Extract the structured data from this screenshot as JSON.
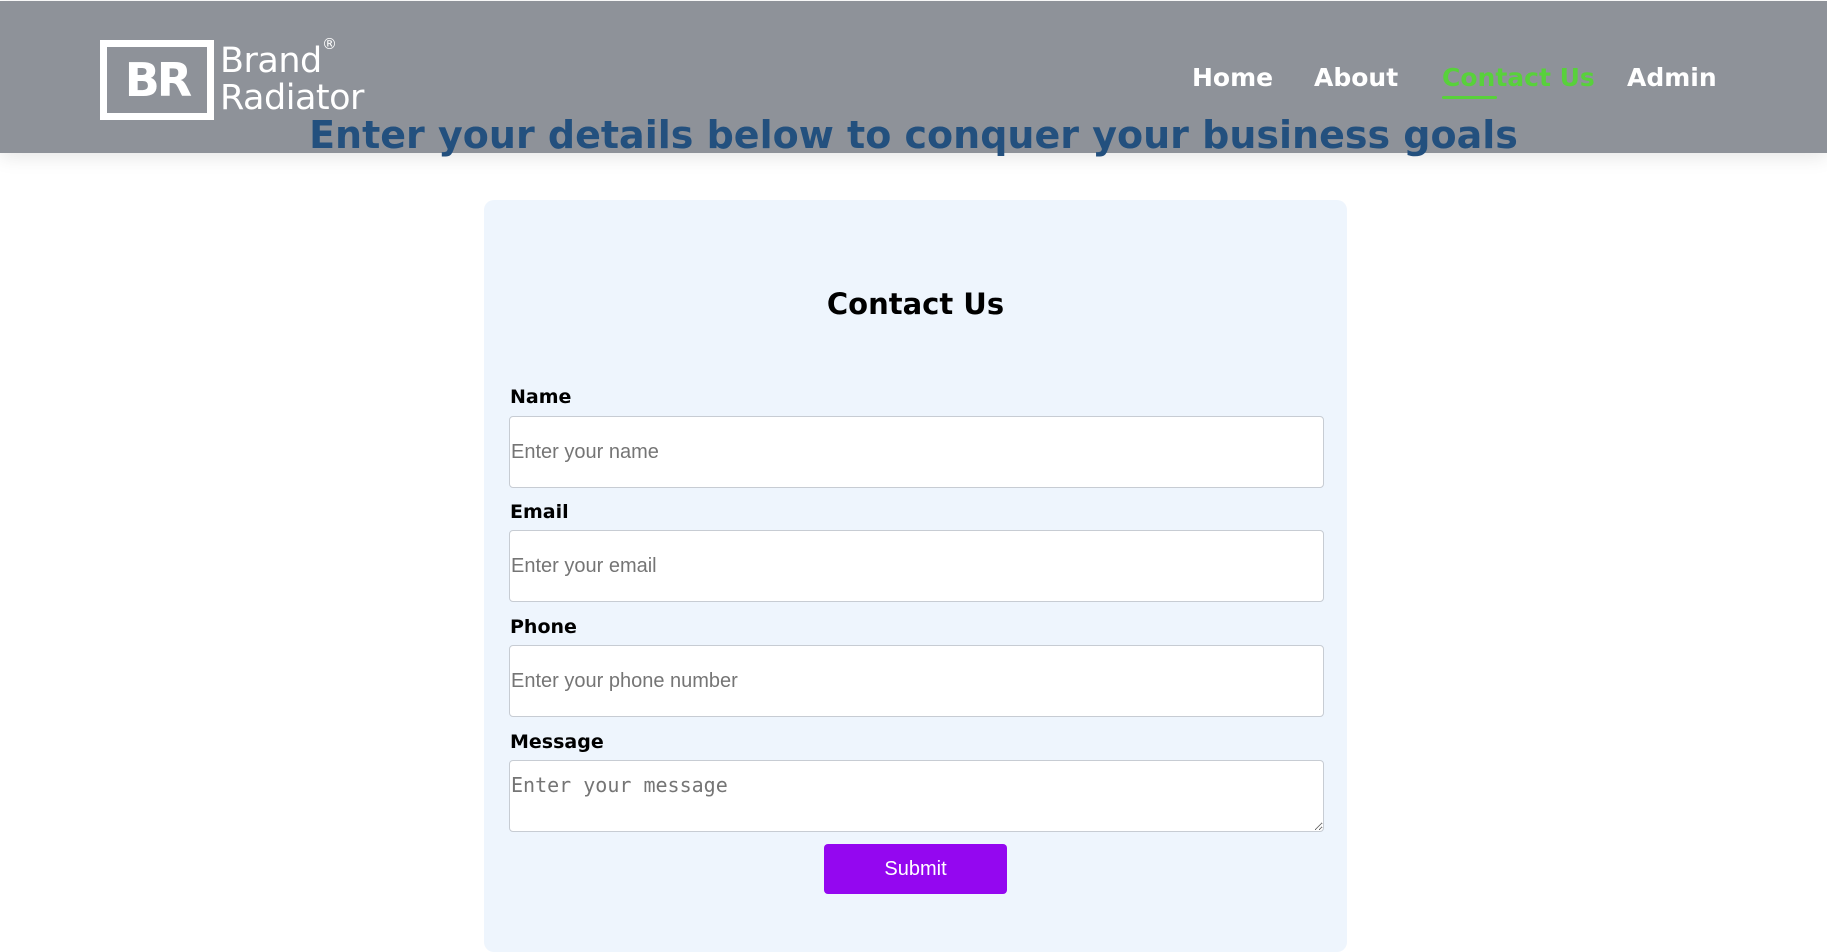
{
  "brand": {
    "mark": "BR",
    "name_line1": "Brand",
    "name_line2": "Radiator",
    "registered": "®"
  },
  "nav": {
    "items": [
      {
        "label": "Home"
      },
      {
        "label": "About"
      },
      {
        "label": "Contact Us",
        "active": true
      },
      {
        "label": "Admin"
      }
    ],
    "active_color": "#58d13b"
  },
  "tagline": "Enter your details below to conquer your business goals",
  "form": {
    "title": "Contact Us",
    "name": {
      "label": "Name",
      "placeholder": "Enter your name",
      "value": ""
    },
    "email": {
      "label": "Email",
      "placeholder": "Enter your email",
      "value": ""
    },
    "phone": {
      "label": "Phone",
      "placeholder": "Enter your phone number",
      "value": ""
    },
    "message": {
      "label": "Message",
      "placeholder": "Enter your message",
      "value": ""
    },
    "submit_label": "Submit",
    "submit_color": "#9407f0"
  },
  "colors": {
    "header_bg": "#8e9299",
    "tagline": "#23507e",
    "card_bg": "#eef5fd"
  }
}
